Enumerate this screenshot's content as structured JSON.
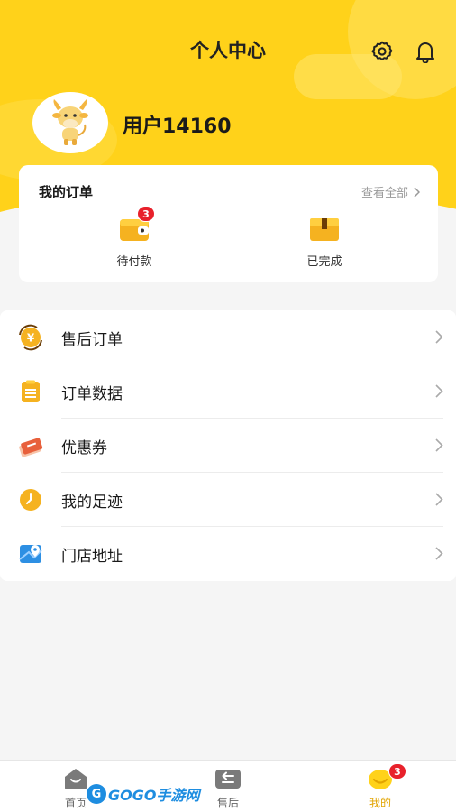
{
  "header": {
    "title": "个人中心",
    "settings_icon": "gear-icon",
    "notification_icon": "bell-icon",
    "accent_color": "#ffd21a"
  },
  "profile": {
    "avatar_icon": "cow-mascot-avatar",
    "username": "用户14160"
  },
  "orders": {
    "title": "我的订单",
    "view_all": "查看全部",
    "items": [
      {
        "label": "待付款",
        "icon": "wallet-icon",
        "badge": "3"
      },
      {
        "label": "已完成",
        "icon": "box-icon"
      }
    ]
  },
  "menu": {
    "items": [
      {
        "label": "售后订单",
        "icon": "yen-refund-icon"
      },
      {
        "label": "订单数据",
        "icon": "clipboard-icon"
      },
      {
        "label": "优惠券",
        "icon": "coupon-icon"
      },
      {
        "label": "我的足迹",
        "icon": "clock-icon"
      },
      {
        "label": "门店地址",
        "icon": "map-pin-icon"
      }
    ]
  },
  "tabbar": {
    "tabs": [
      {
        "label": "首页",
        "icon": "home-icon"
      },
      {
        "label": "售后",
        "icon": "return-icon"
      },
      {
        "label": "我的",
        "icon": "smile-icon",
        "badge": "3",
        "active": true
      }
    ],
    "active_color": "#e2a400"
  },
  "watermark": {
    "text": "GOGO手游网"
  }
}
